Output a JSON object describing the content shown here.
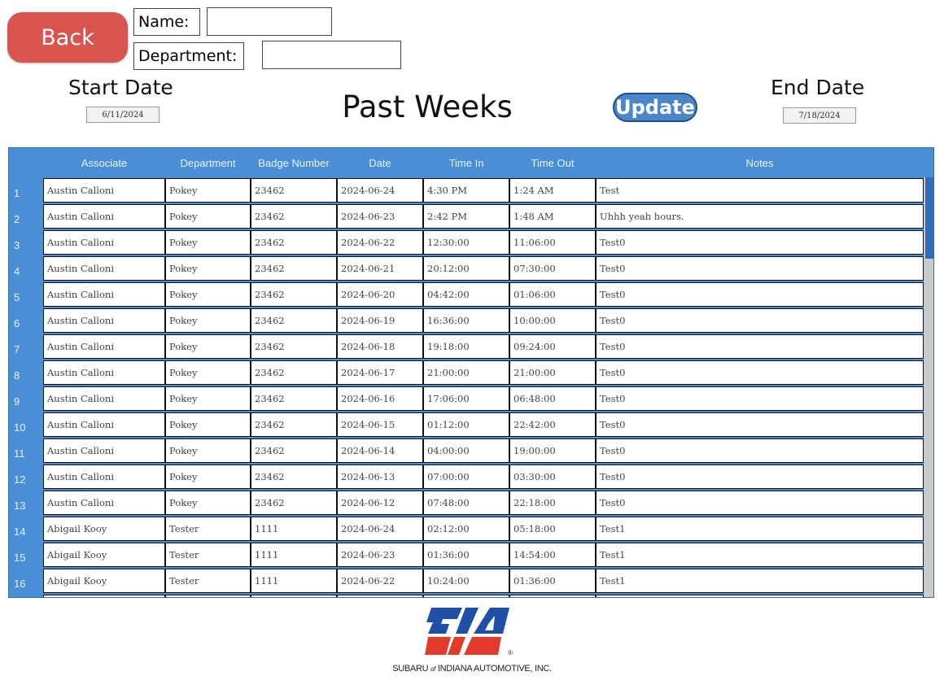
{
  "back_label": "Back",
  "name_label": "Name:",
  "name_value": "",
  "department_label": "Department:",
  "department_value": "",
  "start_date_label": "Start Date",
  "start_date_value": "6/11/2024",
  "end_date_label": "End Date",
  "end_date_value": "7/18/2024",
  "title": "Past Weeks",
  "update_label": "Update",
  "table": {
    "columns": [
      "Associate",
      "Department",
      "Badge Number",
      "Date",
      "Time In",
      "Time Out",
      "Notes"
    ],
    "rows": [
      {
        "num": "1",
        "associate": "Austin Calloni",
        "department": "Pokey",
        "badge": "23462",
        "date": "2024-06-24",
        "time_in": "4:30 PM",
        "time_out": "1:24 AM",
        "notes": "Test"
      },
      {
        "num": "2",
        "associate": "Austin Calloni",
        "department": "Pokey",
        "badge": "23462",
        "date": "2024-06-23",
        "time_in": "2:42 PM",
        "time_out": "1:48 AM",
        "notes": "Uhhh yeah hours."
      },
      {
        "num": "3",
        "associate": "Austin Calloni",
        "department": "Pokey",
        "badge": "23462",
        "date": "2024-06-22",
        "time_in": "12:30:00",
        "time_out": "11:06:00",
        "notes": "Test0"
      },
      {
        "num": "4",
        "associate": "Austin Calloni",
        "department": "Pokey",
        "badge": "23462",
        "date": "2024-06-21",
        "time_in": "20:12:00",
        "time_out": "07:30:00",
        "notes": "Test0"
      },
      {
        "num": "5",
        "associate": "Austin Calloni",
        "department": "Pokey",
        "badge": "23462",
        "date": "2024-06-20",
        "time_in": "04:42:00",
        "time_out": "01:06:00",
        "notes": "Test0"
      },
      {
        "num": "6",
        "associate": "Austin Calloni",
        "department": "Pokey",
        "badge": "23462",
        "date": "2024-06-19",
        "time_in": "16:36:00",
        "time_out": "10:00:00",
        "notes": "Test0"
      },
      {
        "num": "7",
        "associate": "Austin Calloni",
        "department": "Pokey",
        "badge": "23462",
        "date": "2024-06-18",
        "time_in": "19:18:00",
        "time_out": "09:24:00",
        "notes": "Test0"
      },
      {
        "num": "8",
        "associate": "Austin Calloni",
        "department": "Pokey",
        "badge": "23462",
        "date": "2024-06-17",
        "time_in": "21:00:00",
        "time_out": "21:00:00",
        "notes": "Test0"
      },
      {
        "num": "9",
        "associate": "Austin Calloni",
        "department": "Pokey",
        "badge": "23462",
        "date": "2024-06-16",
        "time_in": "17:06:00",
        "time_out": "06:48:00",
        "notes": "Test0"
      },
      {
        "num": "10",
        "associate": "Austin Calloni",
        "department": "Pokey",
        "badge": "23462",
        "date": "2024-06-15",
        "time_in": "01:12:00",
        "time_out": "22:42:00",
        "notes": "Test0"
      },
      {
        "num": "11",
        "associate": "Austin Calloni",
        "department": "Pokey",
        "badge": "23462",
        "date": "2024-06-14",
        "time_in": "04:00:00",
        "time_out": "19:00:00",
        "notes": "Test0"
      },
      {
        "num": "12",
        "associate": "Austin Calloni",
        "department": "Pokey",
        "badge": "23462",
        "date": "2024-06-13",
        "time_in": "07:00:00",
        "time_out": "03:30:00",
        "notes": "Test0"
      },
      {
        "num": "13",
        "associate": "Austin Calloni",
        "department": "Pokey",
        "badge": "23462",
        "date": "2024-06-12",
        "time_in": "07:48:00",
        "time_out": "22:18:00",
        "notes": "Test0"
      },
      {
        "num": "14",
        "associate": "Abigail Kooy",
        "department": "Tester",
        "badge": "1111",
        "date": "2024-06-24",
        "time_in": "02:12:00",
        "time_out": "05:18:00",
        "notes": "Test1"
      },
      {
        "num": "15",
        "associate": "Abigail Kooy",
        "department": "Tester",
        "badge": "1111",
        "date": "2024-06-23",
        "time_in": "01:36:00",
        "time_out": "14:54:00",
        "notes": "Test1"
      },
      {
        "num": "16",
        "associate": "Abigail Kooy",
        "department": "Tester",
        "badge": "1111",
        "date": "2024-06-22",
        "time_in": "10:24:00",
        "time_out": "01:36:00",
        "notes": "Test1"
      },
      {
        "num": "",
        "associate": "",
        "department": "",
        "badge": "",
        "date": "",
        "time_in": "",
        "time_out": "",
        "notes": ""
      }
    ]
  },
  "logo": {
    "brand_colors": {
      "blue": "#1f4fa8",
      "red": "#e23a2b"
    },
    "company_pre": "SUBARU",
    "company_of": "of",
    "company_post": "INDIANA AUTOMOTIVE, INC."
  }
}
